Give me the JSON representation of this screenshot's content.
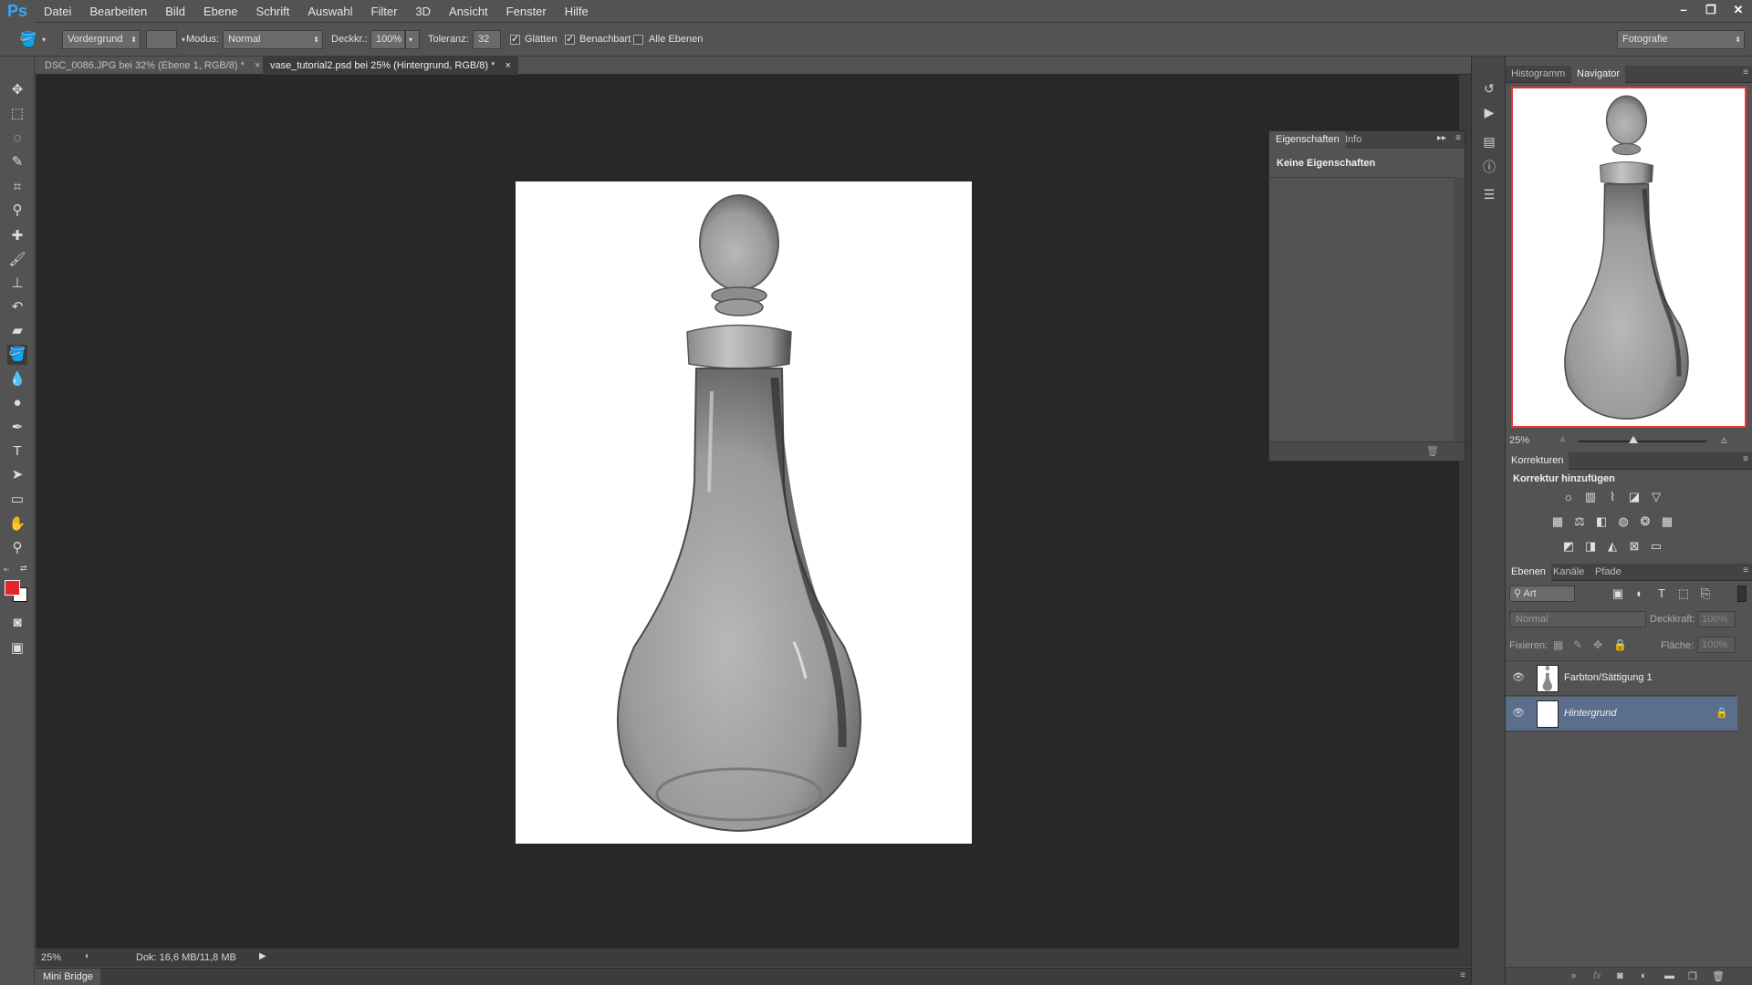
{
  "app": {
    "logo": "Ps"
  },
  "menu": [
    "Datei",
    "Bearbeiten",
    "Bild",
    "Ebene",
    "Schrift",
    "Auswahl",
    "Filter",
    "3D",
    "Ansicht",
    "Fenster",
    "Hilfe"
  ],
  "window_controls": [
    "–",
    "❐",
    "✕"
  ],
  "options": {
    "fill_source": "Vordergrund",
    "mode_label": "Modus:",
    "mode_value": "Normal",
    "opacity_label": "Deckkr.:",
    "opacity_value": "100%",
    "tolerance_label": "Toleranz:",
    "tolerance_value": "32",
    "smooth_label": "Glätten",
    "smooth_checked": true,
    "contiguous_label": "Benachbart",
    "contiguous_checked": true,
    "all_layers_label": "Alle Ebenen",
    "all_layers_checked": false,
    "workspace": "Fotografie"
  },
  "doc_tabs": [
    {
      "label": "DSC_0086.JPG bei 32% (Ebene 1, RGB/8) *",
      "active": false
    },
    {
      "label": "vase_tutorial2.psd bei 25% (Hintergrund, RGB/8) *",
      "active": true
    }
  ],
  "tab_close": "×",
  "status": {
    "zoom": "25%",
    "doc": "Dok: 16,6 MB/11,8 MB"
  },
  "mini_bridge": "Mini Bridge",
  "properties_panel": {
    "tabs": [
      "Eigenschaften",
      "Info"
    ],
    "message": "Keine Eigenschaften"
  },
  "navigator_panel": {
    "tabs": [
      "Histogramm",
      "Navigator"
    ],
    "active_tab": "Navigator",
    "zoom": "25%"
  },
  "adjustments_panel": {
    "title": "Korrekturen",
    "subtitle": "Korrektur hinzufügen",
    "icons_row1": [
      "brightness-icon",
      "levels-icon",
      "curves-icon",
      "exposure-icon",
      "vibrance-icon"
    ],
    "icons_row2": [
      "hue-saturation-icon",
      "color-balance-icon",
      "black-white-icon",
      "photo-filter-icon",
      "channel-mixer-icon",
      "color-lookup-icon"
    ],
    "icons_row3": [
      "invert-icon",
      "posterize-icon",
      "threshold-icon",
      "selective-color-icon",
      "gradient-map-icon"
    ]
  },
  "layers_panel": {
    "tabs": [
      "Ebenen",
      "Kanäle",
      "Pfade"
    ],
    "filter_kind": "Art",
    "blend_mode": "Normal",
    "opacity_label": "Deckkraft:",
    "opacity_value": "100%",
    "lock_label": "Fixieren:",
    "fill_label": "Fläche:",
    "fill_value": "100%",
    "layers": [
      {
        "name": "Farbton/Sättigung 1",
        "selected": false,
        "locked": false
      },
      {
        "name": "Hintergrund",
        "selected": true,
        "locked": true
      }
    ]
  },
  "colors": {
    "foreground": "#e3262a",
    "background": "#ffffff",
    "accent": "#31a8ff"
  }
}
